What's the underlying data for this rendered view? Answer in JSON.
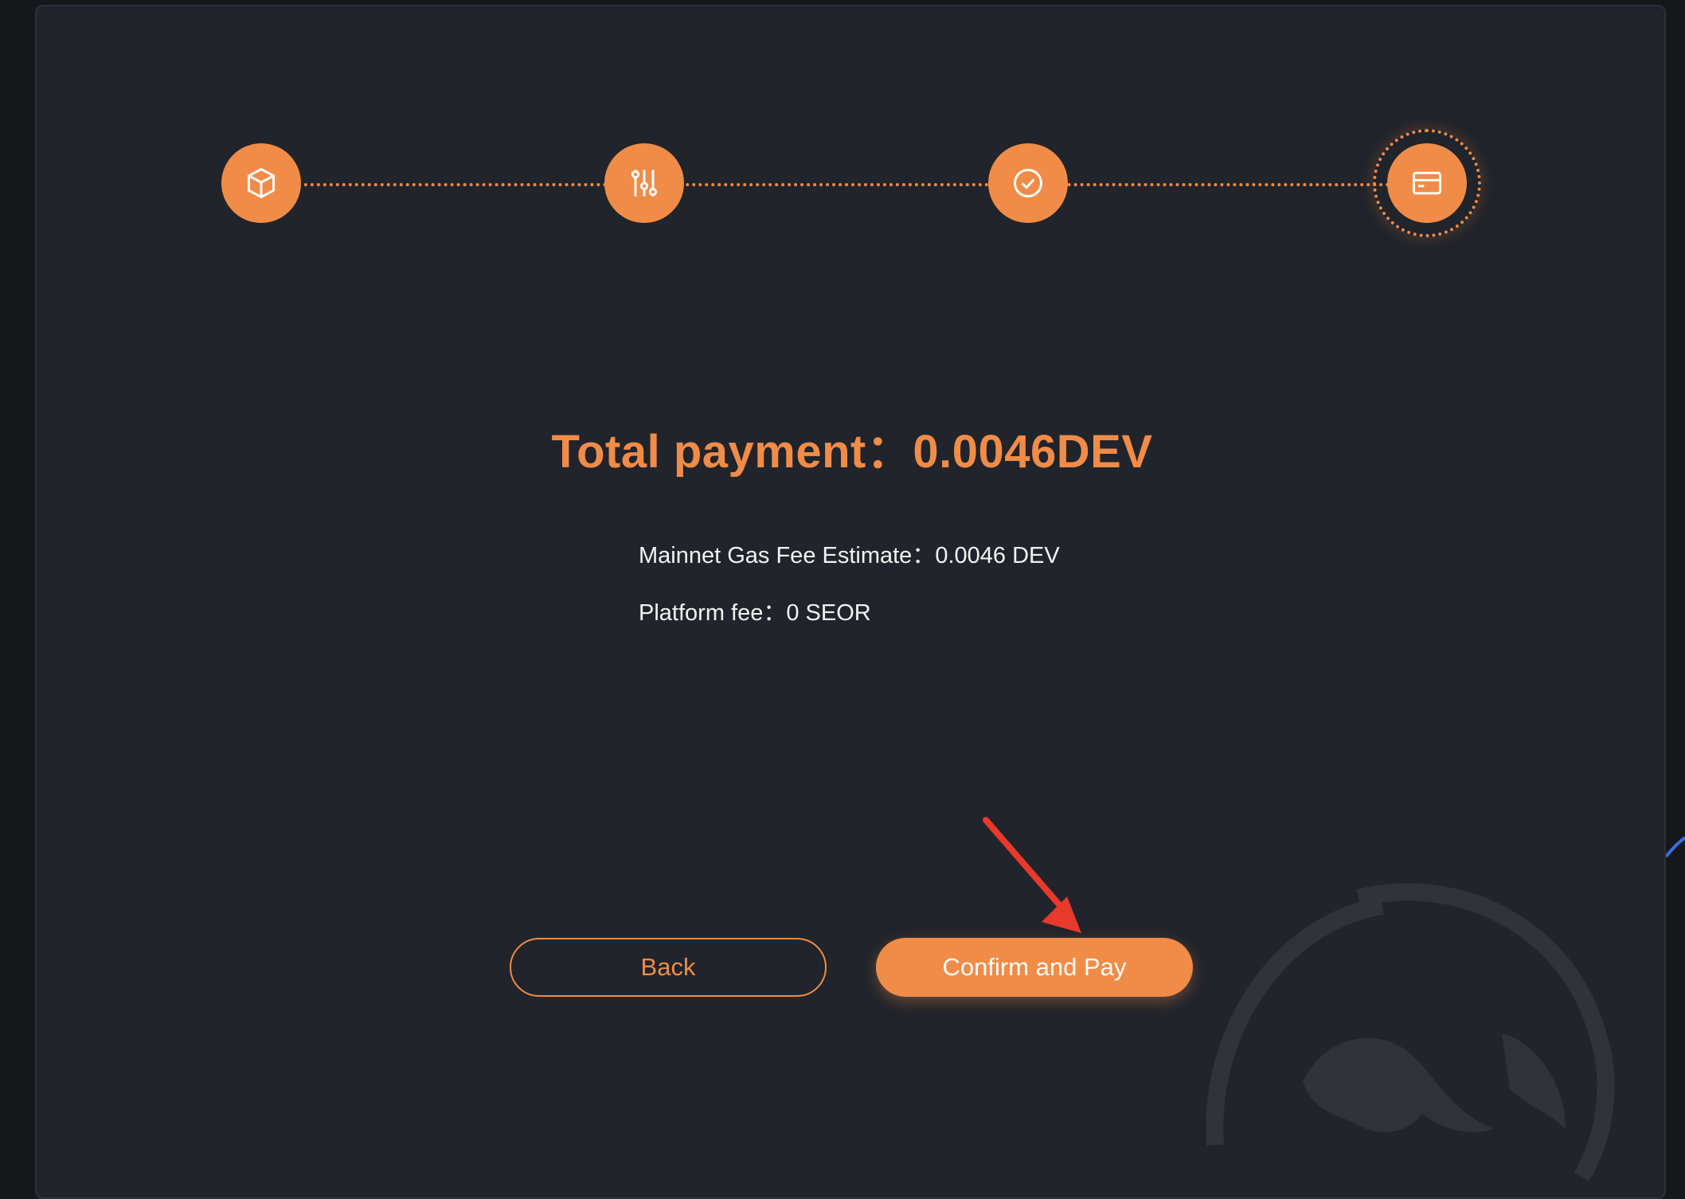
{
  "payment": {
    "total_label": "Total payment：",
    "total_value": "0.0046DEV",
    "gas_fee_label": "Mainnet Gas Fee Estimate：",
    "gas_fee_value": "0.0046 DEV",
    "platform_fee_label": "Platform fee：",
    "platform_fee_value": "0 SEOR"
  },
  "stepper": {
    "steps": [
      {
        "icon": "cube-icon",
        "status": "done"
      },
      {
        "icon": "sliders-icon",
        "status": "done"
      },
      {
        "icon": "check-circle-icon",
        "status": "done"
      },
      {
        "icon": "card-icon",
        "status": "active"
      }
    ]
  },
  "actions": {
    "back_label": "Back",
    "confirm_label": "Confirm and Pay"
  },
  "colors": {
    "accent": "#f08c47",
    "panel_bg": "#21242b",
    "page_bg": "#15171b",
    "annotation_arrow": "#e8392a"
  }
}
